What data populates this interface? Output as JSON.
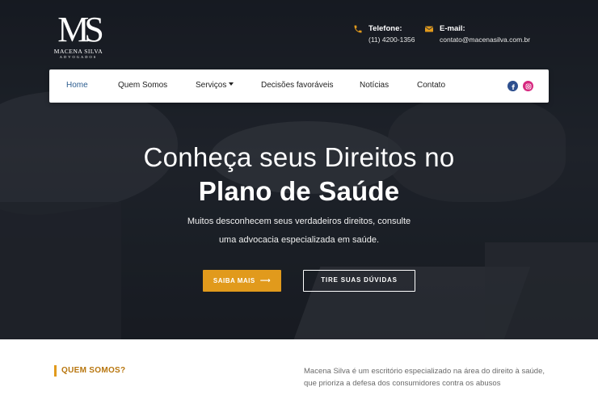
{
  "brand": {
    "logo_mark": "MS",
    "logo_name": "MACENA SILVA",
    "logo_sub": "ADVOGADOS"
  },
  "contact": {
    "phone_title": "Telefone:",
    "phone_value": "(11) 4200-1356",
    "email_title": "E-mail:",
    "email_value": "contato@macenasilva.com.br",
    "icon_color": "#e19a1c"
  },
  "nav": {
    "items": [
      {
        "label": "Home",
        "active": true
      },
      {
        "label": "Quem Somos"
      },
      {
        "label": "Serviços",
        "dropdown": true
      },
      {
        "label": "Decisões favoráveis"
      },
      {
        "label": "Notícias"
      },
      {
        "label": "Contato"
      }
    ],
    "social": [
      "facebook-icon",
      "instagram-icon"
    ]
  },
  "hero": {
    "title_line1": "Conheça seus Direitos no",
    "title_line2": "Plano de Saúde",
    "subtitle_line1": "Muitos desconhecem seus verdadeiros direitos, consulte",
    "subtitle_line2": "uma advocacia especializada em saúde.",
    "primary_button": "SAIBA MAIS",
    "secondary_button": "TIRE SUAS DÚVIDAS"
  },
  "about": {
    "label": "QUEM SOMOS?",
    "text": "Macena Silva é um escritório especializado na área do direito à saúde, que prioriza a defesa dos consumidores contra os abusos"
  },
  "colors": {
    "accent": "#e19a1c",
    "nav_active": "#2b5c8f",
    "facebook": "#2d4f8e",
    "instagram": "#d6287f"
  }
}
